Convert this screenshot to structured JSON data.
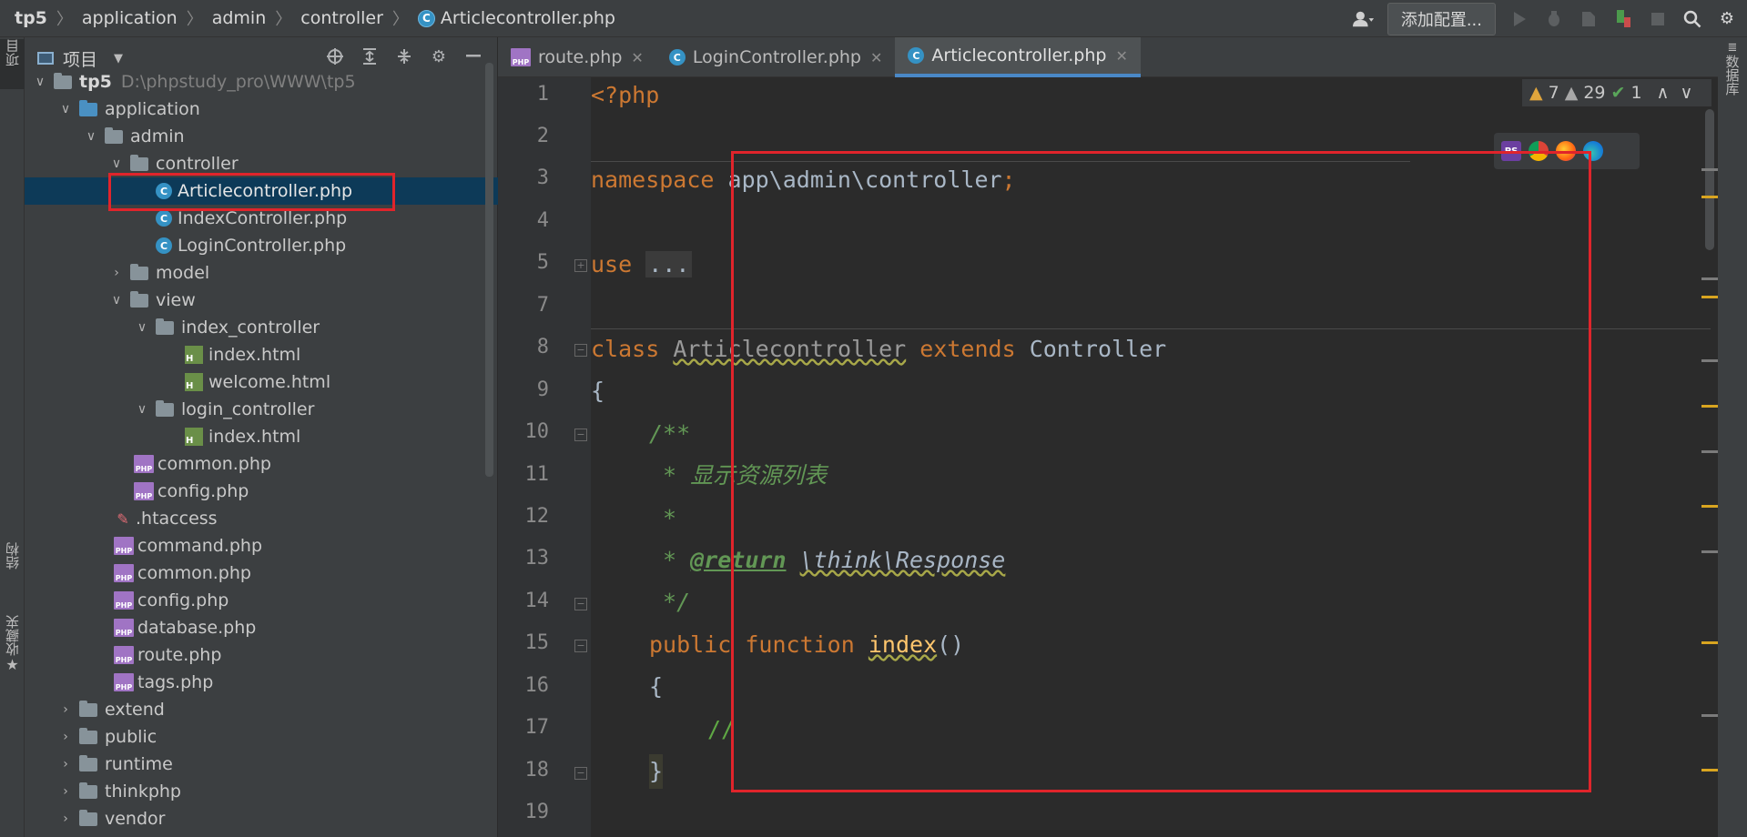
{
  "navbar": {
    "crumbs": [
      "tp5",
      "application",
      "admin",
      "controller",
      "Articlecontroller.php"
    ],
    "add_config_label": "添加配置..."
  },
  "left_strip": {
    "project_label": "项目",
    "structure_label": "结构",
    "favorites_label": "收藏夹"
  },
  "right_strip": {
    "database_label": "数据库"
  },
  "project_panel": {
    "title": "项目",
    "items": [
      {
        "label": "tp5",
        "path": "D:\\phpstudy_pro\\WWW\\tp5"
      },
      {
        "label": "application"
      },
      {
        "label": "admin"
      },
      {
        "label": "controller"
      },
      {
        "label": "Articlecontroller.php"
      },
      {
        "label": "IndexController.php"
      },
      {
        "label": "LoginController.php"
      },
      {
        "label": "model"
      },
      {
        "label": "view"
      },
      {
        "label": "index_controller"
      },
      {
        "label": "index.html"
      },
      {
        "label": "welcome.html"
      },
      {
        "label": "login_controller"
      },
      {
        "label": "index.html"
      },
      {
        "label": "common.php"
      },
      {
        "label": "config.php"
      },
      {
        "label": ".htaccess"
      },
      {
        "label": "command.php"
      },
      {
        "label": "common.php"
      },
      {
        "label": "config.php"
      },
      {
        "label": "database.php"
      },
      {
        "label": "route.php"
      },
      {
        "label": "tags.php"
      },
      {
        "label": "extend"
      },
      {
        "label": "public"
      },
      {
        "label": "runtime"
      },
      {
        "label": "thinkphp"
      },
      {
        "label": "vendor"
      }
    ]
  },
  "tabs": [
    {
      "label": "route.php"
    },
    {
      "label": "LoginController.php"
    },
    {
      "label": "Articlecontroller.php"
    }
  ],
  "inspections": {
    "warnings": "7",
    "weak_warnings": "29",
    "ok": "1"
  },
  "editor": {
    "line_numbers": [
      "1",
      "2",
      "3",
      "4",
      "5",
      "7",
      "8",
      "9",
      "10",
      "11",
      "12",
      "13",
      "14",
      "15",
      "16",
      "17",
      "18",
      "19"
    ],
    "lines": {
      "l1": "<?php",
      "l3_kw": "namespace",
      "l3_rest": " app\\admin\\controller",
      "l3_semi": ";",
      "l5_kw": "use",
      "l5_fold": "...",
      "l8_kw1": "class",
      "l8_name": "Articlecontroller",
      "l8_kw2": "extends",
      "l8_parent": "Controller",
      "l9": "{",
      "l10": "/**",
      "l11": " * 显示资源列表",
      "l12": " *",
      "l13_a": " * ",
      "l13_tag": "@return",
      "l13_type": "\\think\\Response",
      "l14": " */",
      "l15_kw1": "public",
      "l15_kw2": "function",
      "l15_fn": "index",
      "l15_paren": "()",
      "l16": "{",
      "l17": "//",
      "l18": "}"
    }
  },
  "icons": {
    "file_class_letter": "C",
    "php_file_label": "PHP",
    "html_file_label": "H",
    "phpstorm_label": "PS"
  }
}
